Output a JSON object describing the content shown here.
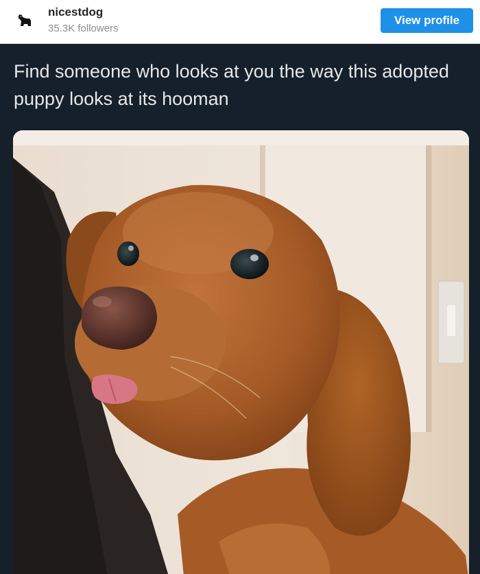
{
  "profile": {
    "username": "nicestdog",
    "followers": "35.3K followers",
    "avatar_icon": "dog-silhouette-icon",
    "view_profile_label": "View profile"
  },
  "post": {
    "text": "Find someone who looks at you the way this adopted puppy looks at its hooman",
    "image_icon": "puppy-photo"
  },
  "colors": {
    "accent": "#1e90e8",
    "post_background": "#15202b",
    "post_text": "#e8e8e8"
  }
}
